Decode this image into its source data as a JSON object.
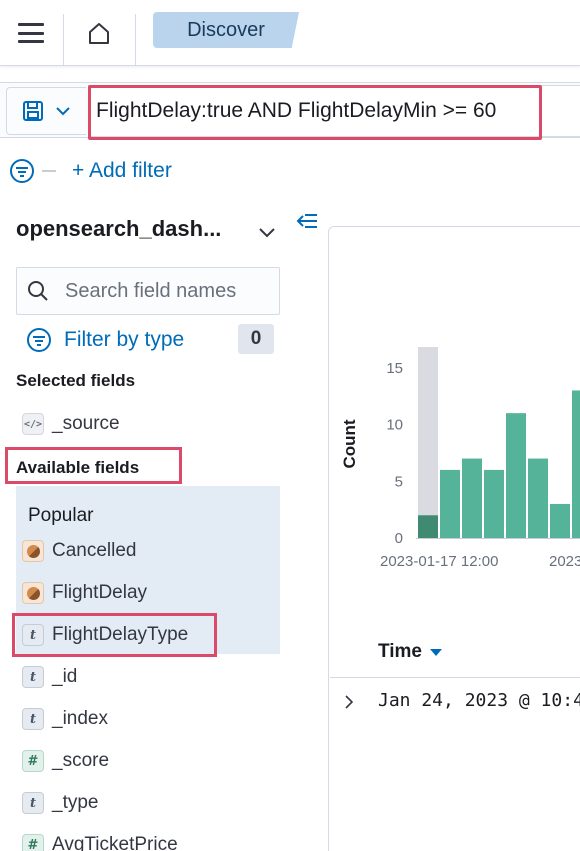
{
  "header": {
    "breadcrumb": "Discover",
    "menu_icon": "hamburger-icon",
    "home_icon": "home-icon"
  },
  "query_bar": {
    "query": "FlightDelay:true AND FlightDelayMin >= 60",
    "saved_icon": "save-icon"
  },
  "filters": {
    "add_filter_label": "+ Add filter"
  },
  "sidebar": {
    "index_pattern": "opensearch_dash...",
    "search_placeholder": "Search field names",
    "filter_by_type_label": "Filter by type",
    "filter_count": "0",
    "selected_fields_title": "Selected fields",
    "selected_fields": [
      {
        "name": "_source",
        "type": "source"
      }
    ],
    "available_fields_title": "Available fields",
    "popular_title": "Popular",
    "popular_fields": [
      {
        "name": "Cancelled",
        "type": "boolean"
      },
      {
        "name": "FlightDelay",
        "type": "boolean"
      },
      {
        "name": "FlightDelayType",
        "type": "string"
      }
    ],
    "other_fields": [
      {
        "name": "_id",
        "type": "string"
      },
      {
        "name": "_index",
        "type": "string"
      },
      {
        "name": "_score",
        "type": "number"
      },
      {
        "name": "_type",
        "type": "string"
      },
      {
        "name": "AvgTicketPrice",
        "type": "number"
      }
    ]
  },
  "chart_data": {
    "type": "bar",
    "ylabel": "Count",
    "xlabel": "",
    "ylim": [
      0,
      17
    ],
    "yticks": [
      "15",
      "10",
      "5",
      "0"
    ],
    "xtick_labels": [
      "2023-01-17 12:00",
      "2023"
    ],
    "values": [
      2,
      6,
      7,
      6,
      11,
      7,
      3,
      13
    ],
    "highlighted_bucket_index": 0,
    "bar_color": "#54b399",
    "highlight_bar_color": "#3f8a70",
    "highlight_band_color": "#d9dbe0"
  },
  "results": {
    "time_header": "Time",
    "rows": [
      {
        "time": "Jan 24, 2023 @ 10:4"
      }
    ]
  }
}
